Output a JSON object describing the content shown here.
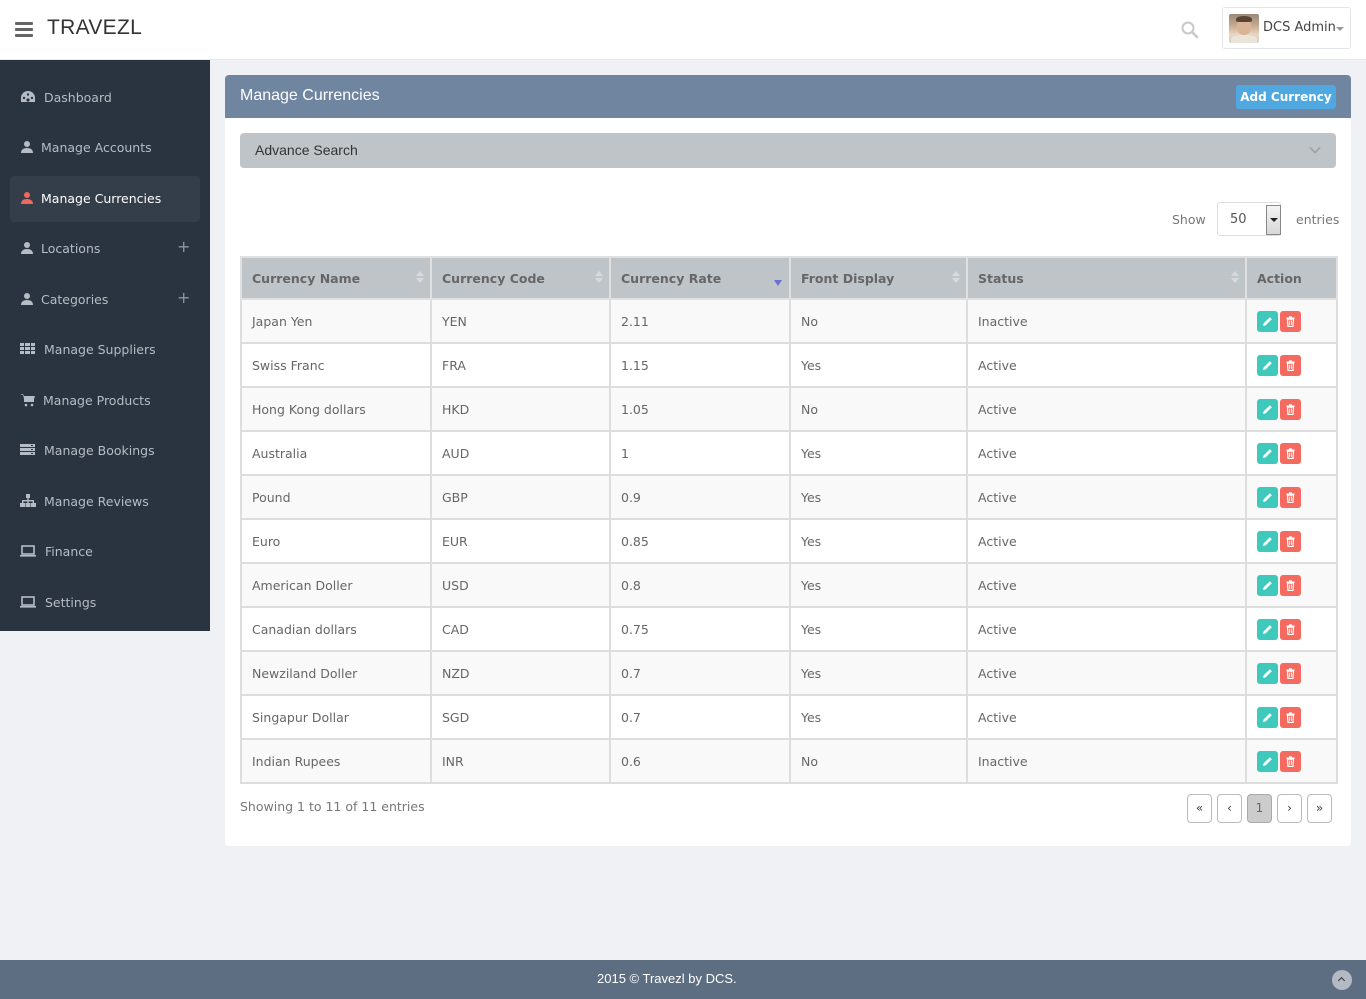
{
  "header": {
    "brand": "TRAVEZL",
    "user_name": "DCS Admin"
  },
  "sidebar": {
    "items": [
      {
        "label": "Dashboard",
        "icon": "dashboard-icon",
        "active": false,
        "expandable": false
      },
      {
        "label": "Manage Accounts",
        "icon": "user-icon",
        "active": false,
        "expandable": false
      },
      {
        "label": "Manage Currencies",
        "icon": "user-icon",
        "active": true,
        "expandable": false
      },
      {
        "label": "Locations",
        "icon": "user-icon",
        "active": false,
        "expandable": true
      },
      {
        "label": "Categories",
        "icon": "user-icon",
        "active": false,
        "expandable": true
      },
      {
        "label": "Manage Suppliers",
        "icon": "grid-icon",
        "active": false,
        "expandable": false
      },
      {
        "label": "Manage Products",
        "icon": "cart-icon",
        "active": false,
        "expandable": false
      },
      {
        "label": "Manage Bookings",
        "icon": "server-icon",
        "active": false,
        "expandable": false
      },
      {
        "label": "Manage Reviews",
        "icon": "sitemap-icon",
        "active": false,
        "expandable": false
      },
      {
        "label": "Finance",
        "icon": "laptop-icon",
        "active": false,
        "expandable": false
      },
      {
        "label": "Settings",
        "icon": "laptop-icon",
        "active": false,
        "expandable": false
      }
    ],
    "expand_symbol": "+"
  },
  "panel": {
    "title": "Manage Currencies",
    "add_button": "Add Currency",
    "advance_search": "Advance Search",
    "show_label": "Show",
    "entries_value": "50",
    "entries_label": "entries"
  },
  "table": {
    "columns": [
      "Currency Name",
      "Currency Code",
      "Currency Rate",
      "Front Display",
      "Status",
      "Action"
    ],
    "sorted_column": "Currency Rate",
    "sort_direction": "desc",
    "rows": [
      {
        "name": "Japan Yen",
        "code": "YEN",
        "rate": "2.11",
        "front_display": "No",
        "status": "Inactive"
      },
      {
        "name": "Swiss Franc",
        "code": "FRA",
        "rate": "1.15",
        "front_display": "Yes",
        "status": "Active"
      },
      {
        "name": "Hong Kong dollars",
        "code": "HKD",
        "rate": "1.05",
        "front_display": "No",
        "status": "Active"
      },
      {
        "name": "Australia",
        "code": "AUD",
        "rate": "1",
        "front_display": "Yes",
        "status": "Active"
      },
      {
        "name": "Pound",
        "code": "GBP",
        "rate": "0.9",
        "front_display": "Yes",
        "status": "Active"
      },
      {
        "name": "Euro",
        "code": "EUR",
        "rate": "0.85",
        "front_display": "Yes",
        "status": "Active"
      },
      {
        "name": "American Doller",
        "code": "USD",
        "rate": "0.8",
        "front_display": "Yes",
        "status": "Active"
      },
      {
        "name": "Canadian dollars",
        "code": "CAD",
        "rate": "0.75",
        "front_display": "Yes",
        "status": "Active"
      },
      {
        "name": "Newziland Doller",
        "code": "NZD",
        "rate": "0.7",
        "front_display": "Yes",
        "status": "Active"
      },
      {
        "name": "Singapur Dollar",
        "code": "SGD",
        "rate": "0.7",
        "front_display": "Yes",
        "status": "Active"
      },
      {
        "name": "Indian Rupees",
        "code": "INR",
        "rate": "0.6",
        "front_display": "No",
        "status": "Inactive"
      }
    ]
  },
  "pagination": {
    "info": "Showing 1 to 11 of 11 entries",
    "first": "«",
    "prev": "‹",
    "current": "1",
    "next": "›",
    "last": "»"
  },
  "footer": {
    "text": "2015 © Travezl by DCS."
  },
  "colors": {
    "sidebar_bg": "#2a3440",
    "panel_header": "#6f85a0",
    "add_button": "#4fa8e0",
    "edit_button": "#3fc9bd",
    "delete_button": "#f46a5f",
    "active_icon": "#f0675c",
    "footer_bg": "#5d6e83"
  }
}
